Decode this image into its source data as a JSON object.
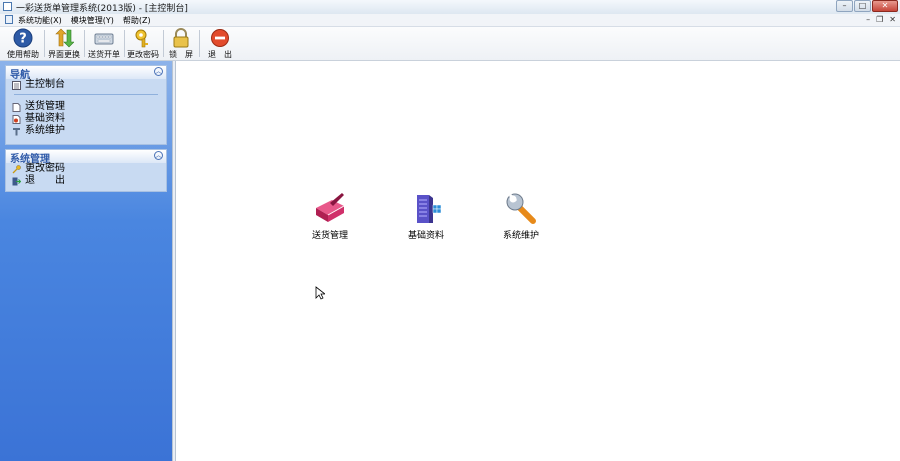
{
  "window": {
    "title": "一彩送货单管理系统(2013版) - [主控制台]"
  },
  "menubar": {
    "items": [
      "系统功能(X)",
      "模块管理(Y)",
      "帮助(Z)"
    ]
  },
  "toolbar": {
    "buttons": [
      {
        "label": "使用帮助",
        "icon": "help-icon"
      },
      {
        "label": "界面更换",
        "icon": "swap-arrows-icon"
      },
      {
        "label": "送货开单",
        "icon": "keyboard-icon"
      },
      {
        "label": "更改密码",
        "icon": "key-icon"
      },
      {
        "label": "锁　屏",
        "icon": "padlock-icon"
      },
      {
        "label": "退　出",
        "icon": "exit-icon"
      }
    ]
  },
  "sidebar": {
    "nav": {
      "title": "导航",
      "items": [
        {
          "label": "主控制台",
          "icon": "console-icon"
        },
        {
          "label": "送货管理",
          "icon": "document-icon"
        },
        {
          "label": "基础资料",
          "icon": "data-icon"
        },
        {
          "label": "系统维护",
          "icon": "wrench-icon"
        }
      ]
    },
    "system": {
      "title": "系统管理",
      "items": [
        {
          "label": "更改密码",
          "icon": "key-icon"
        },
        {
          "label": "退　　出",
          "icon": "exit-icon"
        }
      ]
    }
  },
  "desktop": {
    "icons": [
      {
        "label": "送货管理",
        "icon": "delivery-book-icon"
      },
      {
        "label": "基础资料",
        "icon": "server-data-icon"
      },
      {
        "label": "系统维护",
        "icon": "wrench-icon"
      }
    ]
  },
  "colors": {
    "sidebar_top": "#8db3ea",
    "sidebar_bottom": "#3b73d6",
    "panel_bg": "#c8daf2",
    "accent_title": "#2f5aa8"
  }
}
